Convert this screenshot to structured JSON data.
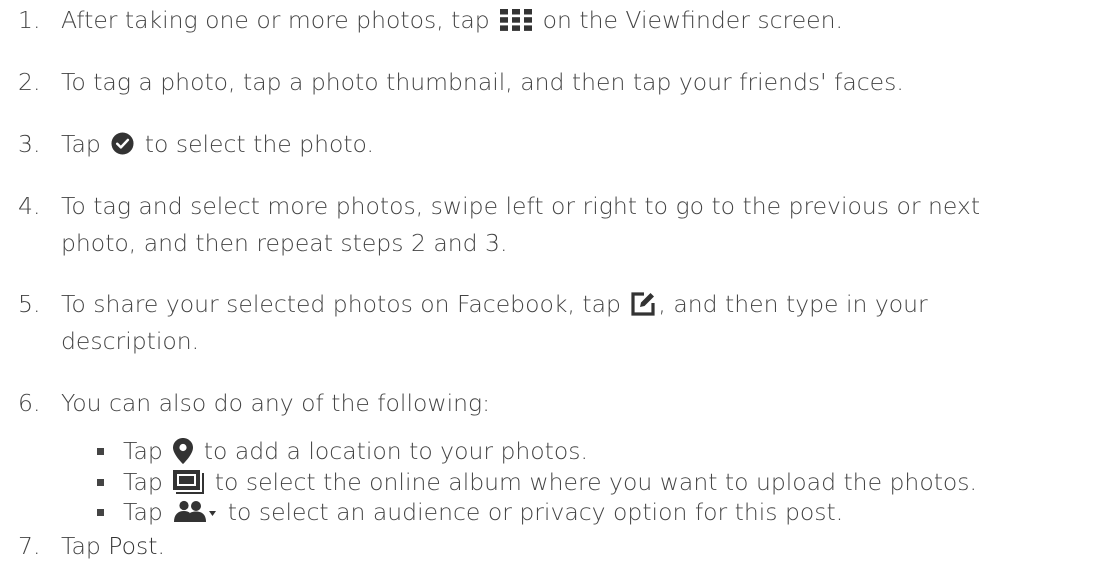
{
  "steps": [
    {
      "num": "1.",
      "before": "After taking one or more photos, tap",
      "icon": "grid-icon",
      "after": "on the Viewfinder screen."
    },
    {
      "num": "2.",
      "text": "To tag a photo, tap a photo thumbnail, and then tap your friends' faces."
    },
    {
      "num": "3.",
      "before": "Tap",
      "icon": "check-circle-icon",
      "after": "to select the photo."
    },
    {
      "num": "4.",
      "line1": "To tag and select more photos, swipe left or right to go to the previous or next",
      "line2": "photo, and then repeat steps 2 and 3."
    },
    {
      "num": "5.",
      "before": "To share your selected photos on Facebook, tap",
      "icon": "edit-icon",
      "after": ", and then type in your",
      "line2": "description."
    },
    {
      "num": "6.",
      "text": "You can also do any of the following:"
    },
    {
      "num": "7.",
      "before": "Tap",
      "post": "Post",
      "after": "."
    }
  ],
  "sub_items": [
    {
      "before": "Tap",
      "icon": "location-pin-icon",
      "after": "to add a location to your photos."
    },
    {
      "before": "Tap",
      "icon": "album-icon",
      "after": "to select the online album where you want to upload the photos."
    },
    {
      "before": "Tap",
      "icon": "audience-icon",
      "after": "to select an audience or privacy option for this post."
    }
  ],
  "colors": {
    "text": "#444444",
    "icon": "#333333"
  }
}
